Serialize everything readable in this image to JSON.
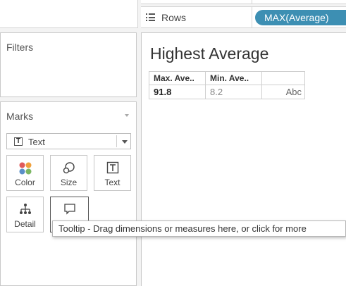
{
  "shelves": {
    "rows_label": "Rows",
    "rows_pill": "MAX(Average)"
  },
  "filters": {
    "title": "Filters"
  },
  "marks": {
    "title": "Marks",
    "mark_type": "Text",
    "buttons": {
      "color": "Color",
      "size": "Size",
      "text": "Text",
      "detail": "Detail"
    }
  },
  "view": {
    "title": "Highest Average",
    "headers": [
      "Max. Ave..",
      "Min. Ave..",
      ""
    ],
    "row": {
      "max": "91.8",
      "min": "8.2",
      "text": "Abc"
    }
  },
  "tooltip": {
    "text": "Tooltip - Drag dimensions or measures here, or click for more"
  },
  "colors": {
    "pill": "#3d8fb3",
    "color_dots": [
      "#e05a5a",
      "#f0a03c",
      "#5b8fc8",
      "#7bb662"
    ]
  }
}
